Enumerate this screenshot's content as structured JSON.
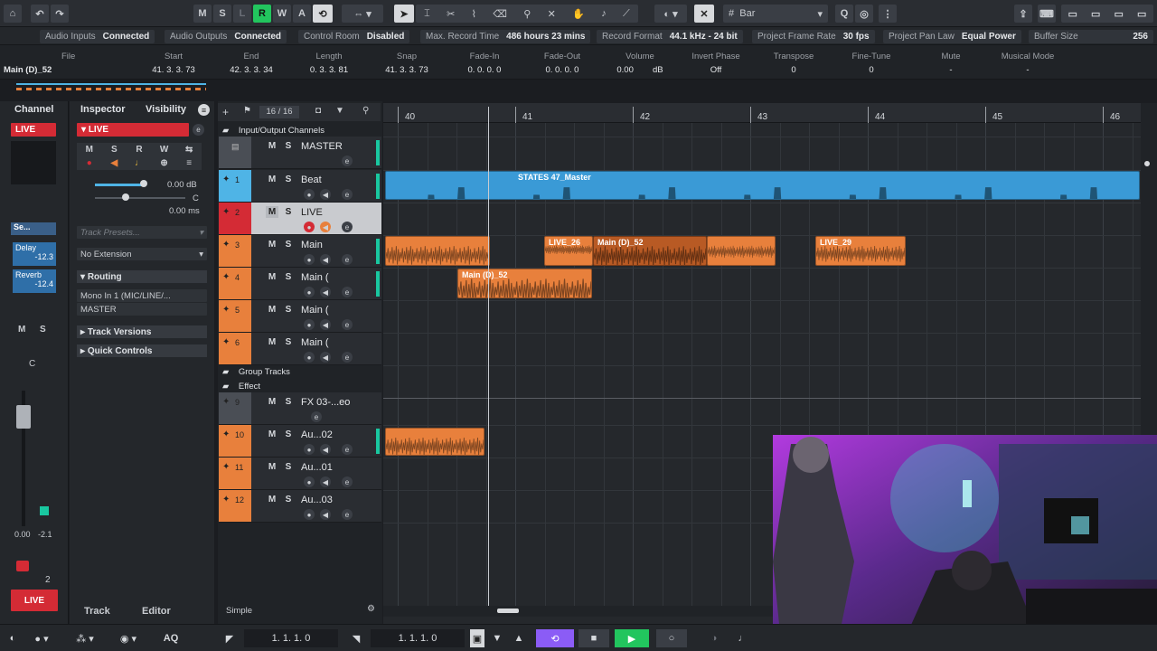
{
  "toolbar": {
    "buttons": [
      "M",
      "S",
      "L",
      "R",
      "W",
      "A"
    ],
    "timebase": "Bar"
  },
  "status": [
    {
      "k": "Audio Inputs",
      "v": "Connected"
    },
    {
      "k": "Audio Outputs",
      "v": "Connected"
    },
    {
      "k": "Control Room",
      "v": "Disabled"
    },
    {
      "k": "Max. Record Time",
      "v": "486 hours 23 mins"
    },
    {
      "k": "Record Format",
      "v": "44.1 kHz - 24 bit"
    },
    {
      "k": "Project Frame Rate",
      "v": "30 fps"
    },
    {
      "k": "Project Pan Law",
      "v": "Equal Power"
    },
    {
      "k": "Buffer Size",
      "v": "256"
    }
  ],
  "info": {
    "file": {
      "h": "File",
      "v": "Main (D)_52"
    },
    "start": {
      "h": "Start",
      "v": "41. 3. 3. 73"
    },
    "end": {
      "h": "End",
      "v": "42. 3. 3. 34"
    },
    "length": {
      "h": "Length",
      "v": "0. 3. 3. 81"
    },
    "snap": {
      "h": "Snap",
      "v": "41. 3. 3. 73"
    },
    "fadein": {
      "h": "Fade-In",
      "v": "0. 0. 0.   0"
    },
    "fadeout": {
      "h": "Fade-Out",
      "v": "0. 0. 0.   0"
    },
    "volume": {
      "h": "Volume",
      "v": "0.00",
      "u": "dB"
    },
    "phase": {
      "h": "Invert Phase",
      "v": "Off"
    },
    "transpose": {
      "h": "Transpose",
      "v": "0"
    },
    "finetune": {
      "h": "Fine-Tune",
      "v": "0"
    },
    "mute": {
      "h": "Mute",
      "v": "-"
    },
    "musical": {
      "h": "Musical Mode",
      "v": "-"
    }
  },
  "channel": {
    "tab": "Channel",
    "name": "LIVE",
    "sends_label": "Se...",
    "inserts": [
      {
        "name": "Delay",
        "v": "-12.3"
      },
      {
        "name": "Reverb",
        "v": "-12.4"
      }
    ],
    "pan": "C",
    "vol": "0.00",
    "peak": "-2.1",
    "chan_num": "2"
  },
  "inspector": {
    "tab": "Inspector",
    "tab2": "Visibility",
    "track": "LIVE",
    "volume": "0.00 dB",
    "pan": "C",
    "delay": "0.00 ms",
    "presets_placeholder": "Track Presets...",
    "extension": "No Extension",
    "routing": "Routing",
    "input": "Mono In 1 (MIC/LINE/...",
    "output": "MASTER",
    "versions": "Track Versions",
    "quick": "Quick Controls",
    "bottom_tabs": [
      "Track",
      "Editor"
    ]
  },
  "tracklist": {
    "count": "16 / 16",
    "folders": {
      "io": "Input/Output Channels",
      "group": "Group Tracks",
      "effect": "Effect"
    },
    "mode": "Simple",
    "tracks": [
      {
        "num": "",
        "name": "MASTER",
        "color": "#4a4e55"
      },
      {
        "num": "1",
        "name": "Beat",
        "color": "#4fb4e6"
      },
      {
        "num": "2",
        "name": "LIVE",
        "color": "#d42b35"
      },
      {
        "num": "3",
        "name": "Main",
        "color": "#e8803c"
      },
      {
        "num": "4",
        "name": "Main (",
        "color": "#e8803c"
      },
      {
        "num": "5",
        "name": "Main (",
        "color": "#e8803c"
      },
      {
        "num": "6",
        "name": "Main (",
        "color": "#e8803c"
      },
      {
        "num": "9",
        "name": "FX 03-...eo",
        "color": "#4a4e55"
      },
      {
        "num": "10",
        "name": "Au...02",
        "color": "#e8803c"
      },
      {
        "num": "11",
        "name": "Au...01",
        "color": "#e8803c"
      },
      {
        "num": "12",
        "name": "Au...03",
        "color": "#e8803c"
      }
    ]
  },
  "ruler": [
    "40",
    "41",
    "42",
    "43",
    "44",
    "45",
    "46"
  ],
  "clips": {
    "beat": "STATES 47_Master",
    "live26": "LIVE_26",
    "main52a": "Main (D)_52",
    "live29": "LIVE_29",
    "main52b": "Main (D)_52"
  },
  "transport": {
    "left": "1. 1. 1.    0",
    "right": "1. 1. 1.    0",
    "aq": "AQ"
  },
  "colors": {
    "accent_green": "#22c55e",
    "record_red": "#d42b35",
    "clip_orange": "#e8803c",
    "clip_blue": "#3a9ad6",
    "loop_purple": "#8b5cf6"
  }
}
